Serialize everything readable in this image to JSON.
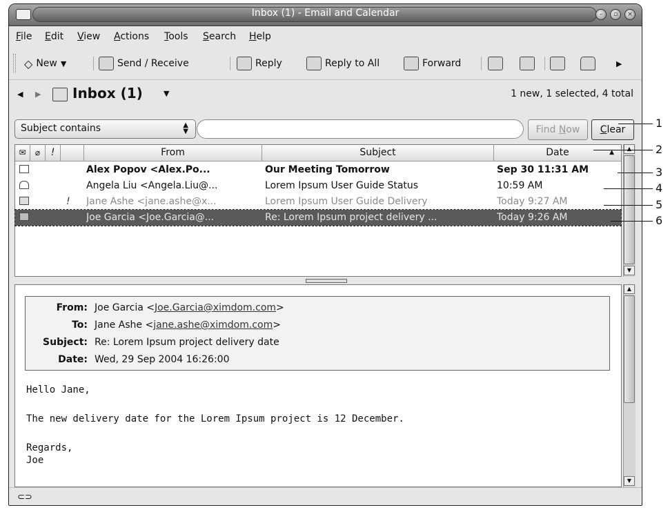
{
  "window": {
    "title": "Inbox (1) - Email and Calendar"
  },
  "menubar": {
    "items": [
      {
        "label": "File",
        "mnemonic": "F",
        "rest": "ile"
      },
      {
        "label": "Edit",
        "mnemonic": "E",
        "rest": "dit"
      },
      {
        "label": "View",
        "mnemonic": "V",
        "rest": "iew"
      },
      {
        "label": "Actions",
        "mnemonic": "A",
        "rest": "ctions"
      },
      {
        "label": "Tools",
        "mnemonic": "T",
        "rest": "ools"
      },
      {
        "label": "Search",
        "mnemonic": "S",
        "rest": "earch"
      },
      {
        "label": "Help",
        "mnemonic": "H",
        "rest": "elp"
      }
    ]
  },
  "toolbar": {
    "new_label": "New",
    "send_receive_label": "Send / Receive",
    "reply_label": "Reply",
    "reply_all_label": "Reply to All",
    "forward_label": "Forward"
  },
  "folder": {
    "name": "Inbox (1)",
    "summary": "1 new, 1 selected, 4 total"
  },
  "search": {
    "criteria": "Subject contains",
    "value": "",
    "find_now_label": "Find Now",
    "find_now_prefix": "Find ",
    "find_now_mnemonic": "N",
    "find_now_rest": "ow",
    "clear_label": "Clear",
    "clear_mnemonic": "C",
    "clear_rest": "lear"
  },
  "message_list": {
    "columns": {
      "flags_status": "",
      "flags_attachment": "",
      "flags_priority": "!",
      "from": "From",
      "subject": "Subject",
      "date": "Date"
    },
    "rows": [
      {
        "from": "Alex Popov <Alex.Po...",
        "subject": "Our Meeting Tomorrow",
        "date": "Sep 30 11:31 AM",
        "priority": "",
        "state": "unread"
      },
      {
        "from": "Angela Liu <Angela.Liu@...",
        "subject": "Lorem Ipsum User Guide Status",
        "date": "10:59 AM",
        "priority": "",
        "state": "read"
      },
      {
        "from": "Jane Ashe <jane.ashe@x...",
        "subject": "Lorem Ipsum User Guide Delivery",
        "date": "Today 9:27 AM",
        "priority": "!",
        "state": "replied"
      },
      {
        "from": "Joe Garcia <Joe.Garcia@...",
        "subject": "Re: Lorem Ipsum project delivery ...",
        "date": "Today 9:26 AM",
        "priority": "",
        "state": "selected"
      }
    ]
  },
  "preview": {
    "from_label": "From:",
    "from_name": "Joe Garcia <",
    "from_email": "Joe.Garcia@ximdom.com",
    "from_close": ">",
    "to_label": "To:",
    "to_name": "Jane Ashe <",
    "to_email": "jane.ashe@ximdom.com",
    "to_close": ">",
    "subject_label": "Subject:",
    "subject_value": "Re: Lorem Ipsum project delivery date",
    "date_label": "Date:",
    "date_value": "Wed, 29 Sep 2004 16:26:00",
    "body_greeting": "Hello Jane,",
    "body_line": "The new delivery date for the Lorem Ipsum project is 12 December.",
    "body_regards": "Regards,",
    "body_signature": "Joe"
  },
  "callouts": [
    "1",
    "2",
    "3",
    "4",
    "5",
    "6"
  ]
}
